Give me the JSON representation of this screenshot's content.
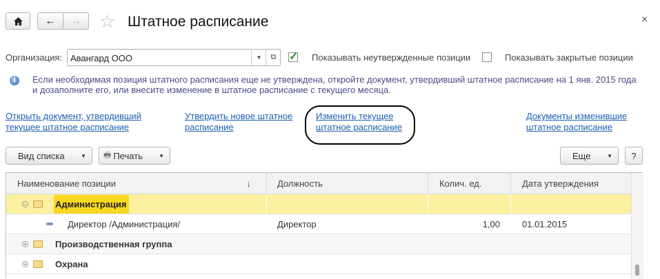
{
  "header": {
    "title": "Штатное расписание",
    "close": "×"
  },
  "filters": {
    "org_label": "Организация:",
    "org_value": "Авангард ООО",
    "show_unapproved": "Показывать неутвержденные позиции",
    "show_unapproved_checked": true,
    "show_closed": "Показывать закрытые позиции",
    "show_closed_checked": false
  },
  "info": {
    "line1": "Если необходимая позиция штатного расписания еще не утверждена, откройте документ, утвердивший штатное расписание на 1 янв. 2015 года",
    "line2": "и дозаполните его, или внесите изменение в штатное расписание с текущего месяца."
  },
  "links": [
    {
      "l1": "Открыть документ, утвердивший",
      "l2": "текущее штатное расписание"
    },
    {
      "l1": "Утвердить новое штатное",
      "l2": "расписание"
    },
    {
      "l1": "Изменить текущее",
      "l2": "штатное расписание"
    },
    {
      "l1": "Документы изменившие",
      "l2": "штатное расписание"
    }
  ],
  "toolbar": {
    "view": "Вид списка",
    "print": "Печать",
    "more": "Еще",
    "help": "?"
  },
  "table": {
    "columns": [
      "Наименование позиции",
      "Должность",
      "Колич. ед.",
      "Дата утверждения"
    ],
    "sort_arrow": "↓",
    "rows": [
      {
        "name": "Администрация",
        "position": "",
        "qty": "",
        "date": "",
        "type": "group",
        "expanded": true
      },
      {
        "name": "Директор /Администрация/",
        "position": "Директор",
        "qty": "1,00",
        "date": "01.01.2015",
        "type": "item"
      },
      {
        "name": "Производственная группа",
        "position": "",
        "qty": "",
        "date": "",
        "type": "group",
        "expanded": false
      },
      {
        "name": "Охрана",
        "position": "",
        "qty": "",
        "date": "",
        "type": "group",
        "expanded": false
      }
    ]
  }
}
